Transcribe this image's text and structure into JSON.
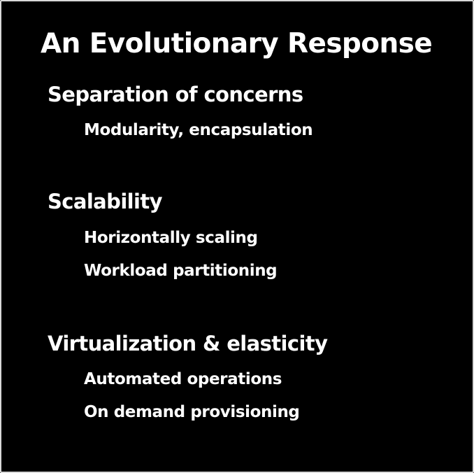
{
  "slide": {
    "title": "An Evolutionary Response",
    "sections": [
      {
        "heading": "Separation of concerns",
        "items": [
          "Modularity, encapsulation"
        ]
      },
      {
        "heading": "Scalability",
        "items": [
          "Horizontally scaling",
          "Workload partitioning"
        ]
      },
      {
        "heading": "Virtualization & elasticity",
        "items": [
          "Automated operations",
          "On demand provisioning"
        ]
      }
    ]
  }
}
